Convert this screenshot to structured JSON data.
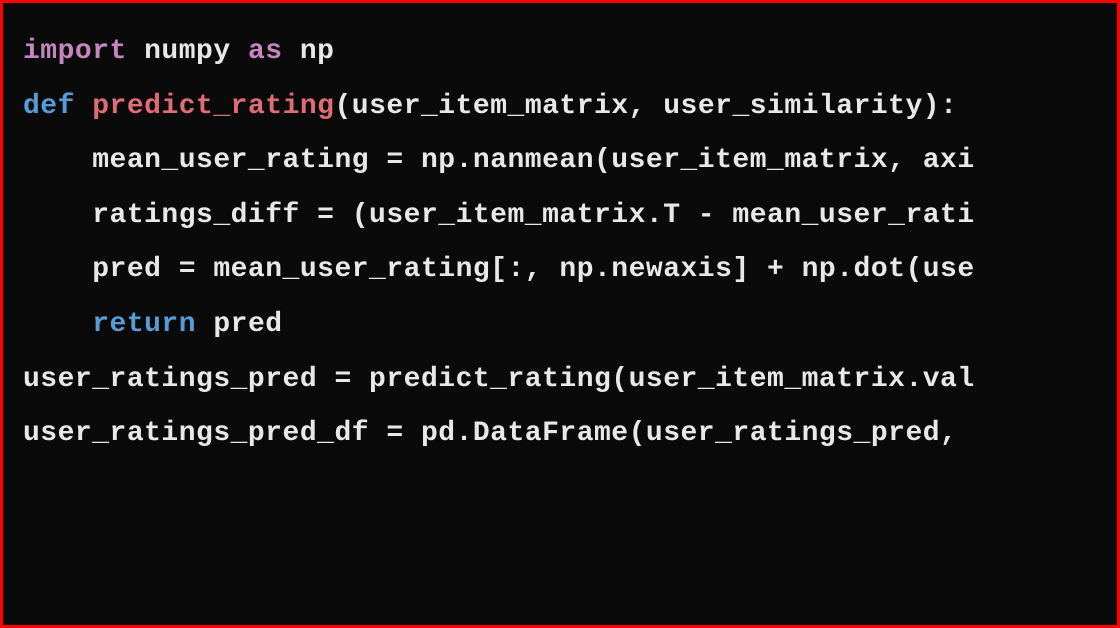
{
  "code": {
    "line1": {
      "import": "import",
      "module": " numpy ",
      "as": "as",
      "alias": " np"
    },
    "line2": "",
    "line3": {
      "def": "def",
      "space": " ",
      "fname": "predict_rating",
      "params": "(user_item_matrix, user_similarity):"
    },
    "line4": "    mean_user_rating = np.nanmean(user_item_matrix, axi",
    "line5": "    ratings_diff = (user_item_matrix.T - mean_user_rati",
    "line6": "    pred = mean_user_rating[:, np.newaxis] + np.dot(use",
    "line7": {
      "indent": "    ",
      "return": "return",
      "value": " pred"
    },
    "line8": "",
    "line9": "user_ratings_pred = predict_rating(user_item_matrix.val",
    "line10": "user_ratings_pred_df = pd.DataFrame(user_ratings_pred, "
  }
}
